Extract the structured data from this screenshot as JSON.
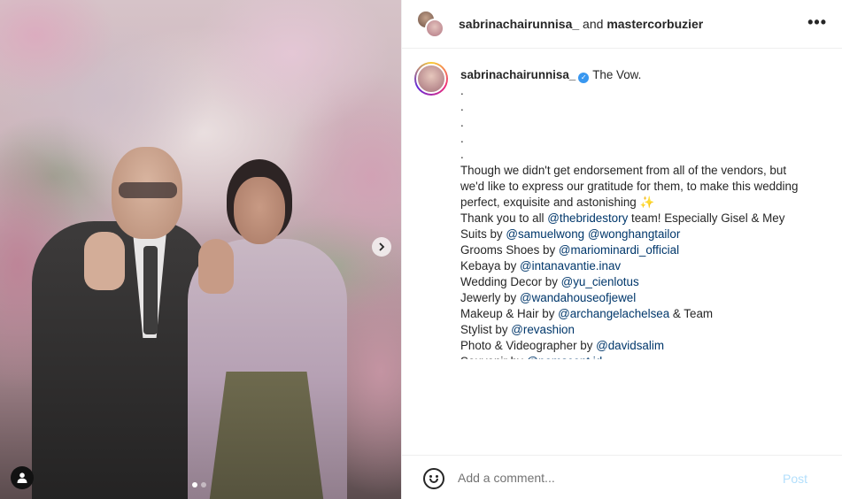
{
  "photo": {
    "carousel_next_icon": "chevron-right-icon",
    "tag_icon": "person-tag-icon",
    "slides_total": 2,
    "slide_active": 1
  },
  "header": {
    "user1": "sabrinachairunnisa_",
    "joiner": " and ",
    "user2": "mastercorbuzier",
    "more_icon": "more-horizontal-icon"
  },
  "caption": {
    "username": "sabrinachairunnisa_",
    "verified_icon": "verified-badge-icon",
    "title": "The Vow.",
    "dots": [
      ".",
      ".",
      ".",
      ".",
      "."
    ],
    "p1_l1": "Though we didn't get endorsement from all of the vendors, but",
    "p1_l2": "we'd like to express our gratitude for them, to make this wedding",
    "p1_l3": "perfect, exquisite and astonishing ✨",
    "thanks_pre": "Thank you to all ",
    "thanks_mention": "@thebridestory",
    "thanks_post": " team! Especially Gisel & Mey",
    "credits": [
      {
        "label": "Suits by ",
        "mentions": [
          "@samuelwong",
          "@wonghangtailor"
        ],
        "suffix": ""
      },
      {
        "label": "Grooms Shoes by ",
        "mentions": [
          "@mariominardi_official"
        ],
        "suffix": ""
      },
      {
        "label": "Kebaya by ",
        "mentions": [
          "@intanavantie.inav"
        ],
        "suffix": ""
      },
      {
        "label": "Wedding Decor by ",
        "mentions": [
          "@yu_cienlotus"
        ],
        "suffix": ""
      },
      {
        "label": "Jewerly by ",
        "mentions": [
          "@wandahouseofjewel"
        ],
        "suffix": ""
      },
      {
        "label": "Makeup & Hair by ",
        "mentions": [
          "@archangelachelsea"
        ],
        "suffix": " & Team"
      },
      {
        "label": "Stylist by ",
        "mentions": [
          "@revashion"
        ],
        "suffix": ""
      },
      {
        "label": "Photo & Videographer by ",
        "mentions": [
          "@davidsalim"
        ],
        "suffix": ""
      },
      {
        "label": "Souvenir by ",
        "mentions": [
          "@pomscent.id"
        ],
        "suffix": ""
      }
    ]
  },
  "comment": {
    "emoji_icon": "emoji-smile-icon",
    "placeholder": "Add a comment...",
    "post_label": "Post"
  }
}
